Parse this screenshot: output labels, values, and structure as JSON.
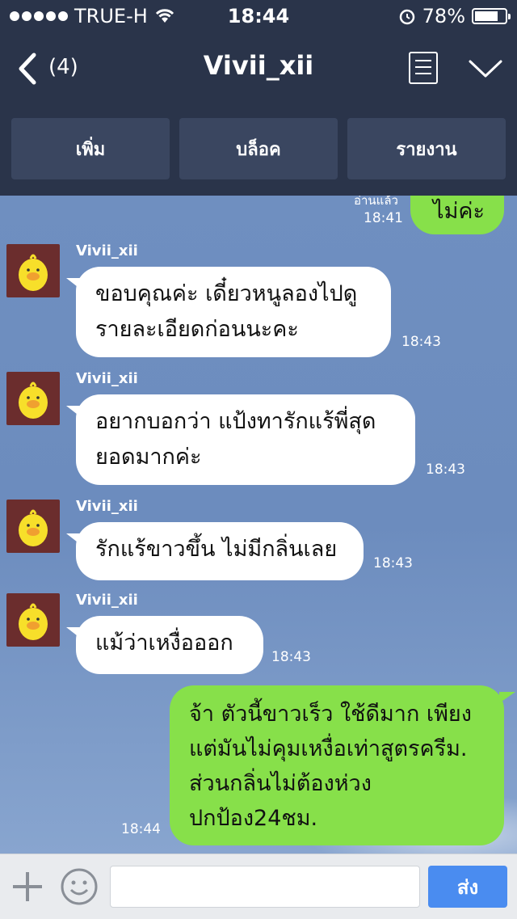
{
  "status": {
    "carrier": "TRUE-H",
    "time": "18:44",
    "battery": "78%",
    "battery_level": 0.78
  },
  "nav": {
    "back_count": "(4)",
    "title": "Vivii_xii"
  },
  "actions": {
    "add": "เพิ่ม",
    "block": "บล็อค",
    "report": "รายงาน"
  },
  "messages": [
    {
      "sender": "me",
      "read": "อ่านแล้ว",
      "time": "18:41",
      "lines": [
        "ไม่ค่ะ"
      ]
    },
    {
      "sender": "Vivii_xii",
      "time": "18:43",
      "lines": [
        "ขอบคุณค่ะ เดี๋ยวหนูลองไปดู",
        "รายละเอียดก่อนนะคะ"
      ]
    },
    {
      "sender": "Vivii_xii",
      "time": "18:43",
      "lines": [
        "อยากบอกว่า แป้งทารักแร้พี่สุด",
        "ยอดมากค่ะ"
      ]
    },
    {
      "sender": "Vivii_xii",
      "time": "18:43",
      "lines": [
        "รักแร้ขาวขึ้น ไม่มีกลิ่นเลย"
      ]
    },
    {
      "sender": "Vivii_xii",
      "time": "18:43",
      "lines": [
        "แม้ว่าเหงื่อออก"
      ]
    },
    {
      "sender": "me",
      "time": "18:44",
      "lines": [
        "จ้า ตัวนี้ขาวเร็ว ใช้ดีมาก เพียง",
        "แต่มันไม่คุมเหงื่อเท่าสูตรครีม.",
        "ส่วนกลิ่นไม่ต้องห่วง",
        "ปกป้อง24ชม."
      ]
    }
  ],
  "composer": {
    "placeholder": "",
    "send": "ส่ง"
  },
  "colors": {
    "header": "#2a344a",
    "my_bubble": "#87e04a",
    "send_button": "#4a8cf0"
  }
}
